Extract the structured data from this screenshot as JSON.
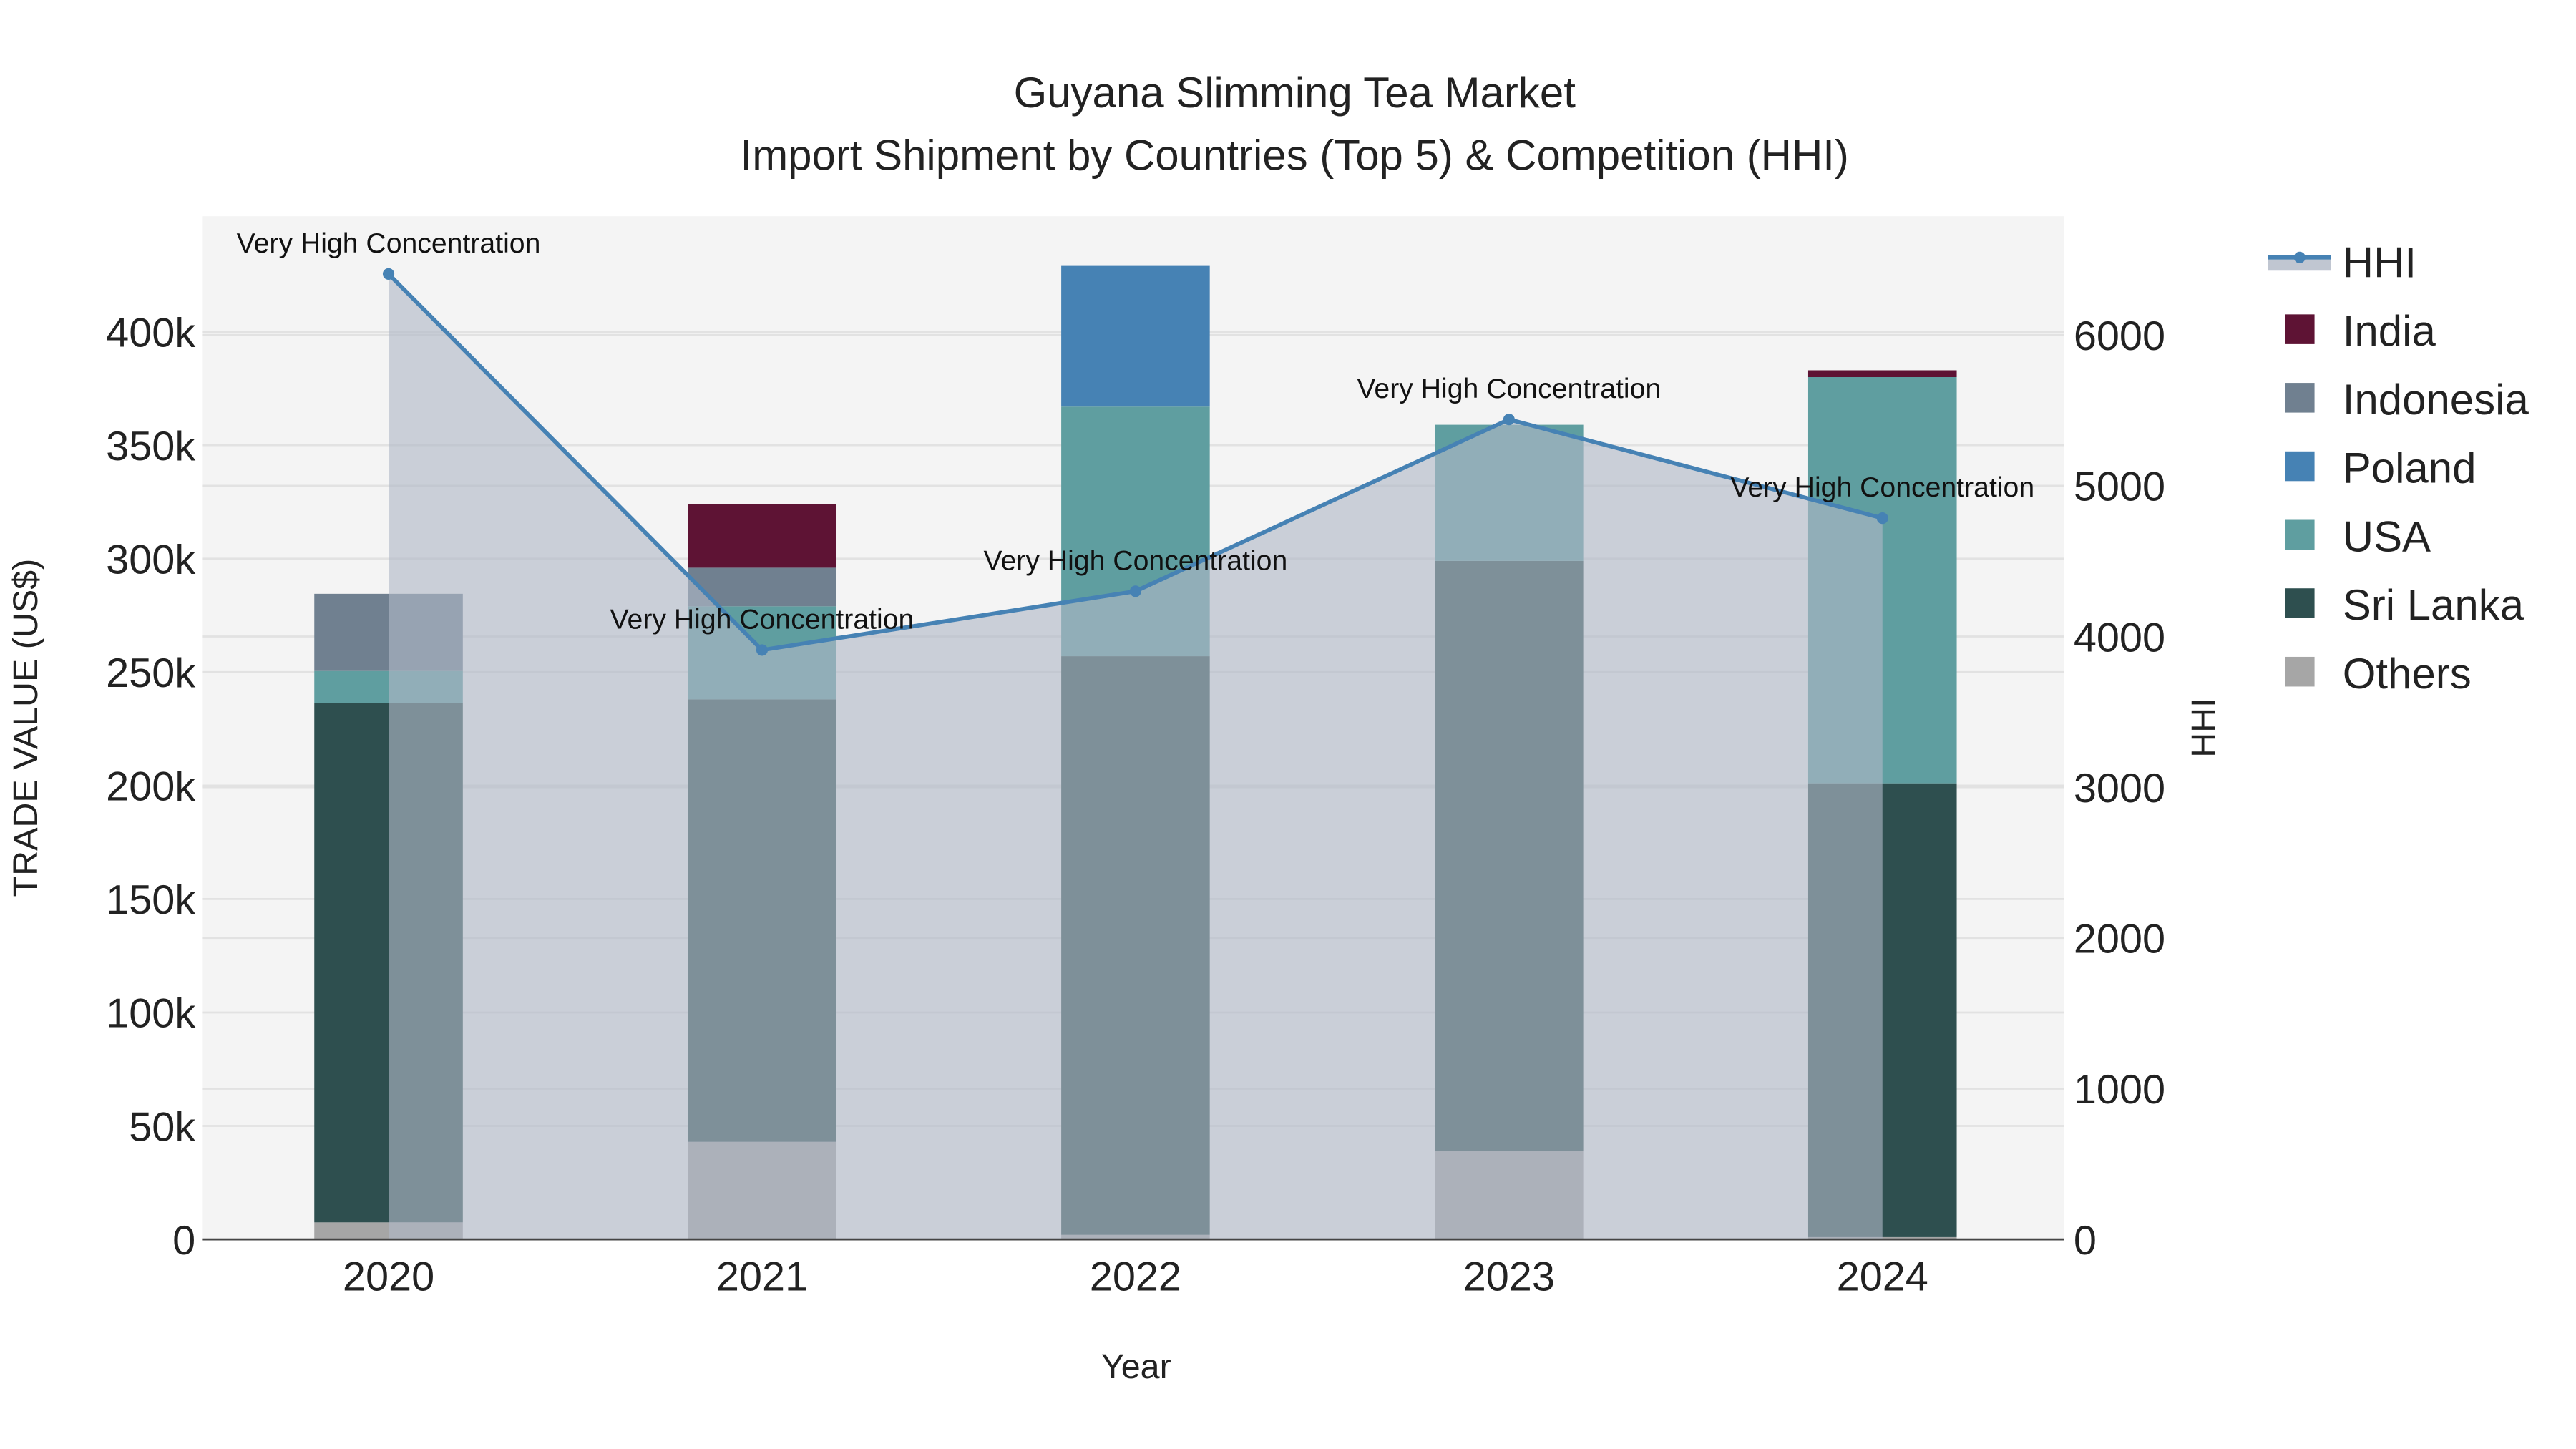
{
  "chart_data": {
    "type": "bar",
    "title": "Guyana Slimming Tea Market",
    "subtitle": "Import Shipment by Countries (Top 5) & Competition (HHI)",
    "xlabel": "Year",
    "ylabel": "TRADE VALUE (US$)",
    "y2label": "HHI",
    "categories": [
      "2020",
      "2021",
      "2022",
      "2023",
      "2024"
    ],
    "ylim": [
      0,
      450000
    ],
    "y2lim": [
      0,
      6800
    ],
    "yticks": [
      0,
      50000,
      100000,
      150000,
      200000,
      250000,
      300000,
      350000,
      400000
    ],
    "ytick_labels": [
      "0",
      "50k",
      "100k",
      "150k",
      "200k",
      "250k",
      "300k",
      "350k",
      "400k"
    ],
    "y2ticks": [
      0,
      1000,
      2000,
      3000,
      4000,
      5000,
      6000
    ],
    "y2tick_labels": [
      "0",
      "1000",
      "2000",
      "3000",
      "4000",
      "5000",
      "6000"
    ],
    "stacked": true,
    "series": [
      {
        "name": "Others",
        "color": "#a6a6a6",
        "values": [
          7500,
          43000,
          2000,
          39000,
          1000
        ]
      },
      {
        "name": "Sri Lanka",
        "color": "#2e4f4f",
        "values": [
          229000,
          195000,
          255000,
          260000,
          200000
        ]
      },
      {
        "name": "USA",
        "color": "#5f9ea0",
        "values": [
          14000,
          41000,
          110000,
          60000,
          179000
        ]
      },
      {
        "name": "Poland",
        "color": "#4682b4",
        "values": [
          0,
          0,
          62000,
          0,
          0
        ]
      },
      {
        "name": "Indonesia",
        "color": "#708090",
        "values": [
          34000,
          17000,
          0,
          0,
          0
        ]
      },
      {
        "name": "India",
        "color": "#5e1334",
        "values": [
          0,
          28000,
          0,
          0,
          3000
        ]
      }
    ],
    "line": {
      "name": "HHI",
      "axis": "right",
      "color": "#4682b4",
      "fill": "tozeroy",
      "values": [
        6405,
        3910,
        4300,
        5440,
        4785
      ]
    },
    "annotations": [
      "Very High Concentration",
      "Very High Concentration",
      "Very High Concentration",
      "Very High Concentration",
      "Very High Concentration"
    ],
    "legend": {
      "placement": "right",
      "entries": [
        "HHI",
        "India",
        "Indonesia",
        "Poland",
        "USA",
        "Sri Lanka",
        "Others"
      ]
    },
    "grid": true
  }
}
